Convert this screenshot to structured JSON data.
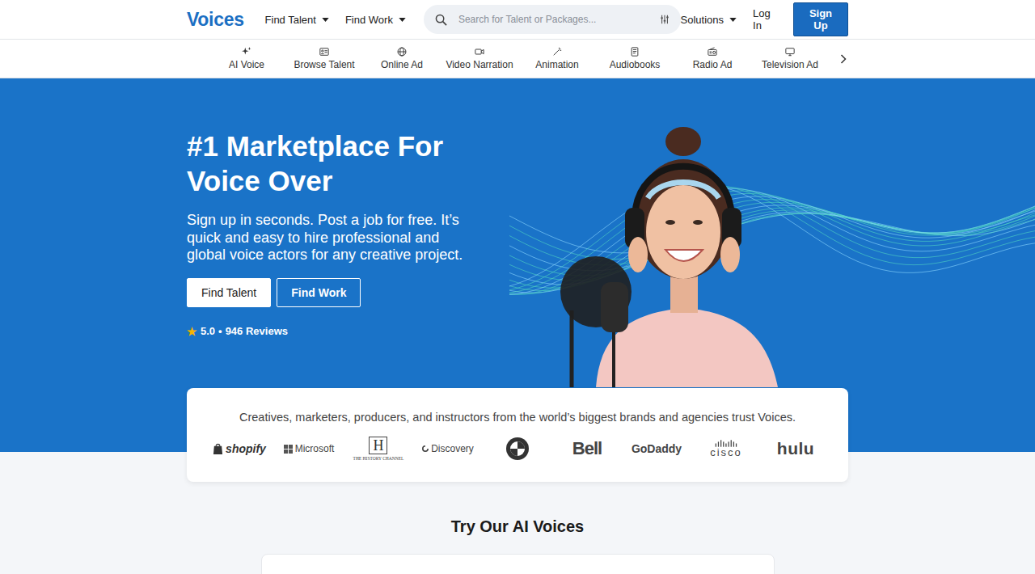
{
  "nav": {
    "logo": "Voices",
    "menus": [
      {
        "label": "Find Talent",
        "dropdown": true
      },
      {
        "label": "Find Work",
        "dropdown": true
      }
    ],
    "search": {
      "placeholder": "Search for Talent or Packages..."
    },
    "solutions": {
      "label": "Solutions",
      "dropdown": true
    },
    "login": "Log In",
    "signup": "Sign Up"
  },
  "categories": [
    {
      "label": "AI Voice",
      "kind": "ai"
    },
    {
      "label": "Browse Talent",
      "kind": "browse"
    },
    {
      "label": "Online Ad",
      "kind": "globe"
    },
    {
      "label": "Video Narration",
      "kind": "video"
    },
    {
      "label": "Animation",
      "kind": "wand"
    },
    {
      "label": "Audiobooks",
      "kind": "book"
    },
    {
      "label": "Radio Ad",
      "kind": "radio"
    },
    {
      "label": "Television Ad",
      "kind": "tv"
    }
  ],
  "hero": {
    "title_lines": [
      "#1 Marketplace For",
      "Voice Over"
    ],
    "subtitle_lines": [
      "Sign up in seconds. Post a job for free. It’s",
      "quick and easy to hire professional and",
      "global voice actors for any creative project."
    ],
    "buttons": [
      {
        "label": "Find Talent",
        "kind": "primary"
      },
      {
        "label": "Find Work",
        "kind": "outline"
      }
    ],
    "rating": {
      "star": "★",
      "score": "5.0",
      "separator": "•",
      "reviews": "946 Reviews"
    }
  },
  "brands": {
    "text": "Creatives, marketers, producers, and instructors from the world’s biggest brands and agencies trust Voices.",
    "logos": [
      {
        "kind": "shopify",
        "text": "shopify"
      },
      {
        "kind": "microsoft",
        "text": "Microsoft"
      },
      {
        "kind": "history",
        "text": "H",
        "sub": "THE HISTORY CHANNEL"
      },
      {
        "kind": "discovery",
        "text": "Discovery"
      },
      {
        "kind": "roundel"
      },
      {
        "kind": "wordmark",
        "text": "Bell"
      },
      {
        "kind": "wordmark",
        "text": "GoDaddy"
      },
      {
        "kind": "cisco",
        "text": "cisco"
      },
      {
        "kind": "wordmark",
        "text": "hulu"
      }
    ]
  },
  "ai_section": {
    "title": "Try Our AI Voices"
  }
}
